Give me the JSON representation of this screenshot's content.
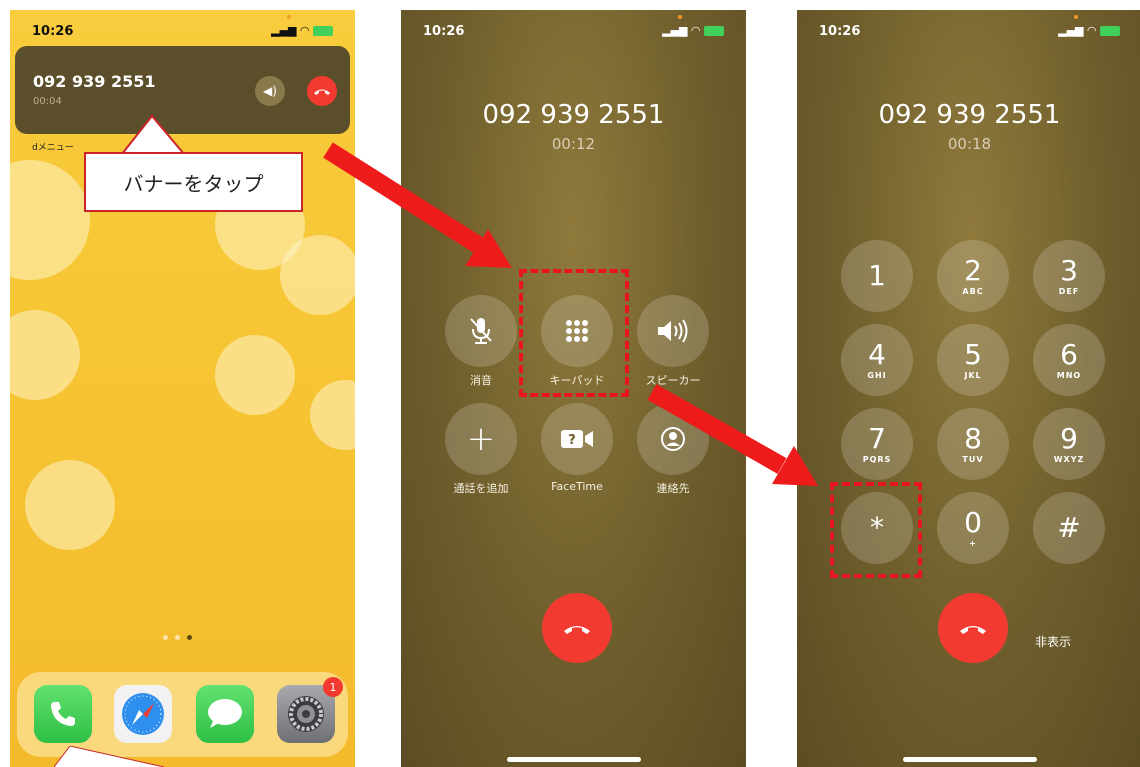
{
  "status": {
    "time": "10:26"
  },
  "home": {
    "banner": {
      "number": "092 939 2551",
      "duration": "00:04"
    },
    "dmenu_label": "dメニュー",
    "dock": {
      "settings_badge": "1"
    }
  },
  "callout_text": "バナーをタップ",
  "call": {
    "number": "092 939 2551",
    "duration": "00:12",
    "buttons": {
      "mute": "消音",
      "keypad": "キーパッド",
      "speaker": "スピーカー",
      "add_call": "通話を追加",
      "facetime": "FaceTime",
      "contacts": "連絡先"
    }
  },
  "keypad_screen": {
    "number": "092 939 2551",
    "duration": "00:18",
    "keys": [
      {
        "digit": "1",
        "letters": ""
      },
      {
        "digit": "2",
        "letters": "ABC"
      },
      {
        "digit": "3",
        "letters": "DEF"
      },
      {
        "digit": "4",
        "letters": "GHI"
      },
      {
        "digit": "5",
        "letters": "JKL"
      },
      {
        "digit": "6",
        "letters": "MNO"
      },
      {
        "digit": "7",
        "letters": "PQRS"
      },
      {
        "digit": "8",
        "letters": "TUV"
      },
      {
        "digit": "9",
        "letters": "WXYZ"
      },
      {
        "digit": "*",
        "letters": ""
      },
      {
        "digit": "0",
        "letters": "+"
      },
      {
        "digit": "#",
        "letters": ""
      }
    ],
    "hide_label": "非表示"
  },
  "colors": {
    "highlight": "#e8141e",
    "end_call": "#f23a31"
  }
}
